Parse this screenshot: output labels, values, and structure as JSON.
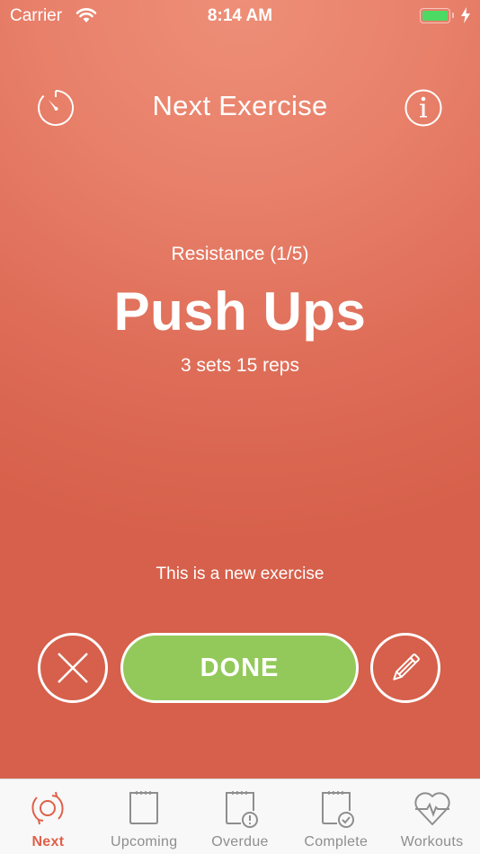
{
  "status_bar": {
    "carrier": "Carrier",
    "time": "8:14 AM",
    "battery_color": "#4cd964"
  },
  "nav": {
    "title": "Next Exercise",
    "left_icon": "stopwatch-icon",
    "right_icon": "info-icon"
  },
  "exercise": {
    "category": "Resistance (1/5)",
    "name": "Push Ups",
    "sets_reps": "3 sets 15 reps",
    "note": "This is a new exercise"
  },
  "actions": {
    "skip_icon": "close-icon",
    "done_label": "DONE",
    "edit_icon": "pencil-icon",
    "done_color": "#93c95a"
  },
  "tabs": [
    {
      "label": "Next",
      "icon": "refresh-target-icon",
      "active": true
    },
    {
      "label": "Upcoming",
      "icon": "notepad-icon",
      "active": false
    },
    {
      "label": "Overdue",
      "icon": "notepad-alert-icon",
      "active": false
    },
    {
      "label": "Complete",
      "icon": "notepad-check-icon",
      "active": false
    },
    {
      "label": "Workouts",
      "icon": "heart-pulse-icon",
      "active": false
    }
  ],
  "colors": {
    "accent": "#e0604a",
    "background_top": "#ee8f78",
    "background_bottom": "#d6604b",
    "tab_inactive": "#8e8e8e"
  }
}
